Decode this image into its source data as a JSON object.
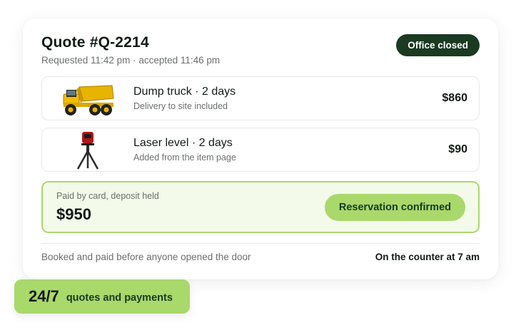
{
  "quote": {
    "title": "Quote #Q-2214",
    "subtitle": "Requested 11:42 pm · accepted 11:46 pm",
    "status": "Office closed"
  },
  "items": [
    {
      "name": "Dump truck · 2 days",
      "note": "Delivery to site included",
      "price": "$860",
      "icon": "dump-truck-icon"
    },
    {
      "name": "Laser level · 2 days",
      "note": "Added from the item page",
      "price": "$90",
      "icon": "laser-level-icon"
    }
  ],
  "payment": {
    "label": "Paid by card, deposit held",
    "amount": "$950",
    "button": "Reservation confirmed"
  },
  "footer": {
    "left": "Booked and paid before anyone opened the door",
    "right": "On the counter at 7 am"
  },
  "badge": {
    "number": "24/7",
    "text": "quotes and payments"
  },
  "colors": {
    "accent": "#a9d86b",
    "dark": "#1a3a21",
    "payment_bg": "#f4faea"
  }
}
